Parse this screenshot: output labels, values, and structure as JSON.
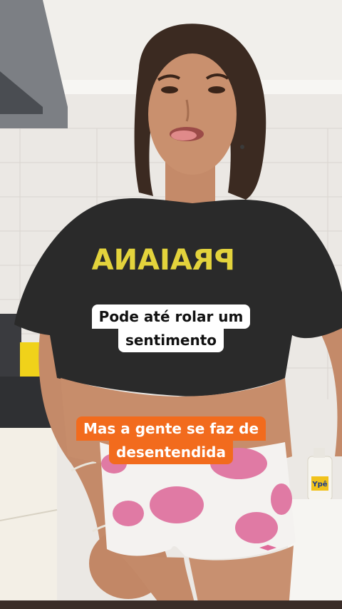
{
  "captions": {
    "top": {
      "line1": "Pode até rolar um",
      "line2": "sentimento"
    },
    "bottom": {
      "line1": "Mas a gente se faz de",
      "line2": "desentendida"
    }
  },
  "scene": {
    "shirt_print": "PRAIANA",
    "bottle_brand": "Ypê"
  },
  "colors": {
    "caption_white_bg": "#ffffff",
    "caption_orange_bg": "#f26b1d",
    "shirt": "#2a2a2a",
    "shirt_print": "#e3d33c",
    "shorts_dots": "#e07aa4",
    "wall_tile": "#ece9e5"
  }
}
